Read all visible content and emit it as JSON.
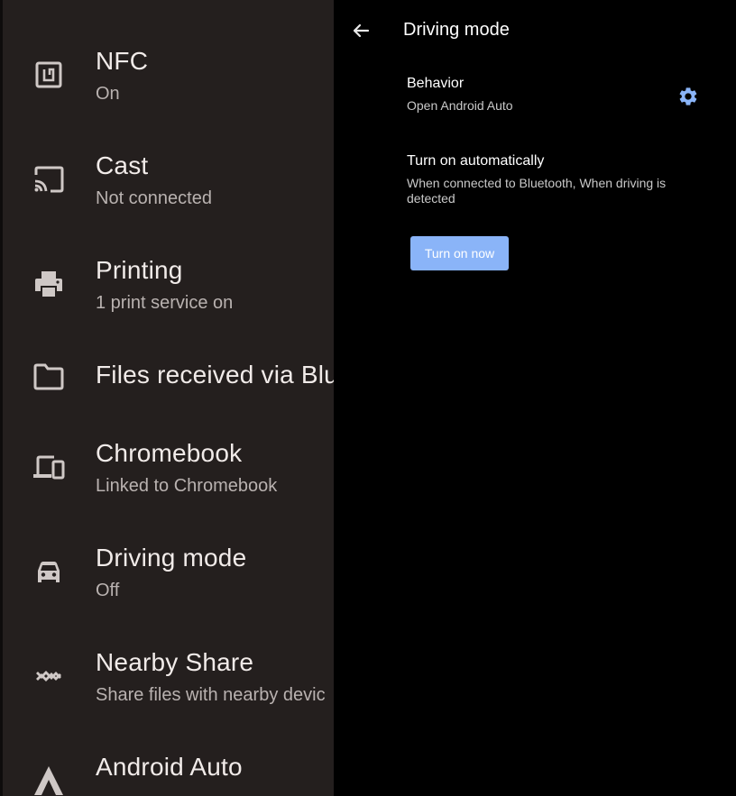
{
  "left_panel": {
    "items": [
      {
        "icon": "nfc-icon",
        "title": "NFC",
        "summary": "On"
      },
      {
        "icon": "cast-icon",
        "title": "Cast",
        "summary": "Not connected"
      },
      {
        "icon": "printer-icon",
        "title": "Printing",
        "summary": "1 print service on"
      },
      {
        "icon": "folder-icon",
        "title": "Files received via Blu",
        "summary": ""
      },
      {
        "icon": "devices-icon",
        "title": "Chromebook",
        "summary": "Linked to Chromebook"
      },
      {
        "icon": "car-icon",
        "title": "Driving mode",
        "summary": "Off"
      },
      {
        "icon": "nearby-share-icon",
        "title": "Nearby Share",
        "summary": "Share files with nearby devic"
      },
      {
        "icon": "android-auto-icon",
        "title": "Android Auto",
        "summary": ""
      }
    ]
  },
  "detail": {
    "back_icon": "arrow-back-icon",
    "title": "Driving mode",
    "behavior": {
      "title": "Behavior",
      "summary": "Open Android Auto",
      "icon": "gear-icon"
    },
    "auto": {
      "title": "Turn on automatically",
      "summary": "When connected to Bluetooth, When driving is detected"
    },
    "turn_on_label": "Turn on now"
  },
  "colors": {
    "left_background": "#241f1e",
    "right_background": "#000000",
    "accent": "#8ab4f8"
  }
}
